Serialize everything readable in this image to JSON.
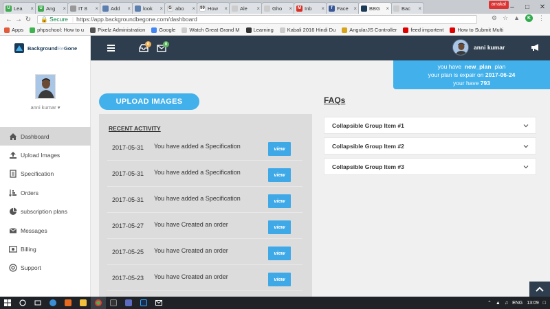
{
  "browser": {
    "tabs": [
      {
        "label": "Lea",
        "color": "#41a950",
        "glyph": "U",
        "active": false
      },
      {
        "label": "Ang",
        "color": "#41a950",
        "glyph": "U",
        "active": false
      },
      {
        "label": "IT 8",
        "color": "#999999",
        "glyph": "",
        "active": false
      },
      {
        "label": "Add",
        "color": "#5d7fb0",
        "glyph": "",
        "active": false
      },
      {
        "label": "look",
        "color": "#5d7fb0",
        "glyph": "",
        "active": false
      },
      {
        "label": "abo",
        "color": "#e9e9e9",
        "glyph": "G",
        "active": false
      },
      {
        "label": "How",
        "color": "#ffffff",
        "glyph": "99",
        "active": false
      },
      {
        "label": "Ale",
        "color": "#cccccc",
        "glyph": "",
        "active": false
      },
      {
        "label": "Gho",
        "color": "#cccccc",
        "glyph": "",
        "active": false
      },
      {
        "label": "Inb",
        "color": "#d93025",
        "glyph": "M",
        "active": false
      },
      {
        "label": "Face",
        "color": "#3b5998",
        "glyph": "f",
        "active": false
      },
      {
        "label": "BBG",
        "color": "#1b3a57",
        "glyph": "",
        "active": true
      },
      {
        "label": "Bac",
        "color": "#cccccc",
        "glyph": "",
        "active": false
      }
    ],
    "window_user": "arrakal",
    "url_secure_label": "Secure",
    "url": "https://app.backgroundbegone.com/dashboard",
    "bookmarks": [
      {
        "label": "Apps",
        "color": "#e25b3b"
      },
      {
        "label": "phpschool: How to u",
        "color": "#3fb34f"
      },
      {
        "label": "Pixelz Administration",
        "color": "#555555"
      },
      {
        "label": "Google",
        "color": "#4285f4"
      },
      {
        "label": "Watch Great Grand M",
        "color": "#cccccc"
      },
      {
        "label": "Learning",
        "color": "#333333"
      },
      {
        "label": "Kabali 2016 Hindi Du",
        "color": "#cccccc"
      },
      {
        "label": "AngularJS Controller",
        "color": "#d9a31a"
      },
      {
        "label": "feed importent",
        "color": "#e00000"
      },
      {
        "label": "How to Submit Multi",
        "color": "#e00000"
      }
    ]
  },
  "app": {
    "logo": {
      "brand_a": "Background",
      "brand_b": "Be",
      "brand_c": "Gone"
    },
    "user_name": "anni kumar",
    "menu": [
      {
        "label": "Dashboard",
        "icon": "home-icon",
        "active": true
      },
      {
        "label": "Upload Images",
        "icon": "upload-icon",
        "active": false
      },
      {
        "label": "Specification",
        "icon": "specification-icon",
        "active": false
      },
      {
        "label": "Orders",
        "icon": "orders-icon",
        "active": false
      },
      {
        "label": "subscription plans",
        "icon": "pie-chart-icon",
        "active": false
      },
      {
        "label": "Messages",
        "icon": "envelope-icon",
        "active": false
      },
      {
        "label": "Billing",
        "icon": "billing-icon",
        "active": false
      },
      {
        "label": "Support",
        "icon": "support-icon",
        "active": false
      }
    ],
    "topbar": {
      "user_name": "anni kumar",
      "notif_badge": "0",
      "msg_badge": "0",
      "bg_color": "#2e3e4e"
    },
    "plan": {
      "line1_prefix": "you have",
      "plan_name": "new_plan",
      "line1_suffix": "plan",
      "line2_prefix": "your plan is expair on",
      "expiry": "2017-06-24",
      "line3_prefix": "your have",
      "count": "793"
    },
    "upload_button": "UPLOAD IMAGES",
    "recent_activity": {
      "title": "RECENT ACTIVITY",
      "view_label": "view",
      "rows": [
        {
          "date": "2017-05-31",
          "text": "You have added a Specification"
        },
        {
          "date": "2017-05-31",
          "text": "You have added a Specification"
        },
        {
          "date": "2017-05-31",
          "text": "You have added a Specification"
        },
        {
          "date": "2017-05-27",
          "text": "You have Created an order"
        },
        {
          "date": "2017-05-25",
          "text": "You have Created an order"
        },
        {
          "date": "2017-05-23",
          "text": "You have Created an order"
        }
      ]
    },
    "faqs": {
      "title": "FAQs",
      "items": [
        "Collapsible Group Item #1",
        "Collapsible Group Item #2",
        "Collapsible Group Item #3"
      ]
    },
    "accent_color": "#42b0ea"
  },
  "taskbar": {
    "language": "ENG",
    "time": "13:09"
  }
}
